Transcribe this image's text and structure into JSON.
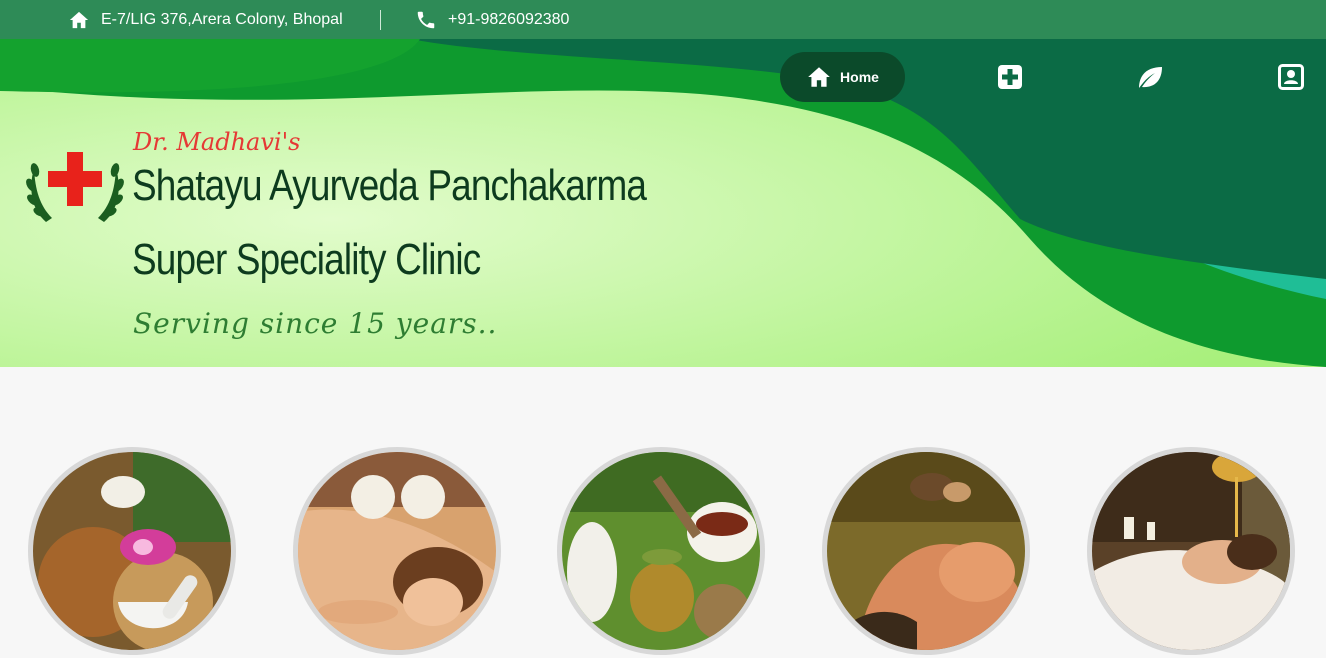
{
  "topbar": {
    "address": "E-7/LIG 376,Arera Colony, Bhopal",
    "phone": "+91-9826092380",
    "icons": [
      "home-icon",
      "phone-icon"
    ]
  },
  "nav": {
    "home_label": "Home",
    "icons": [
      "home-icon",
      "medical-plus-icon",
      "leaf-icon",
      "contact-card-icon"
    ]
  },
  "brand": {
    "doctor": "Dr. Madhavi's",
    "title_line1": "Shatayu Ayurveda Panchakarma",
    "title_line2": "Super Speciality Clinic",
    "tagline": "Serving since 15 years.."
  },
  "colors": {
    "topbar": "#2e8b57",
    "dark_green": "#0b6b45",
    "accent_red": "#e53935",
    "title_green": "#0d3b1e"
  },
  "treatments": [
    {
      "image": "herbs-mortar-orchid-photo"
    },
    {
      "image": "herbal-poultice-massage-photo"
    },
    {
      "image": "ayurvedic-herbs-vessels-photo"
    },
    {
      "image": "shirodhara-oil-treatment-photo"
    },
    {
      "image": "spa-oil-pouring-photo"
    }
  ]
}
